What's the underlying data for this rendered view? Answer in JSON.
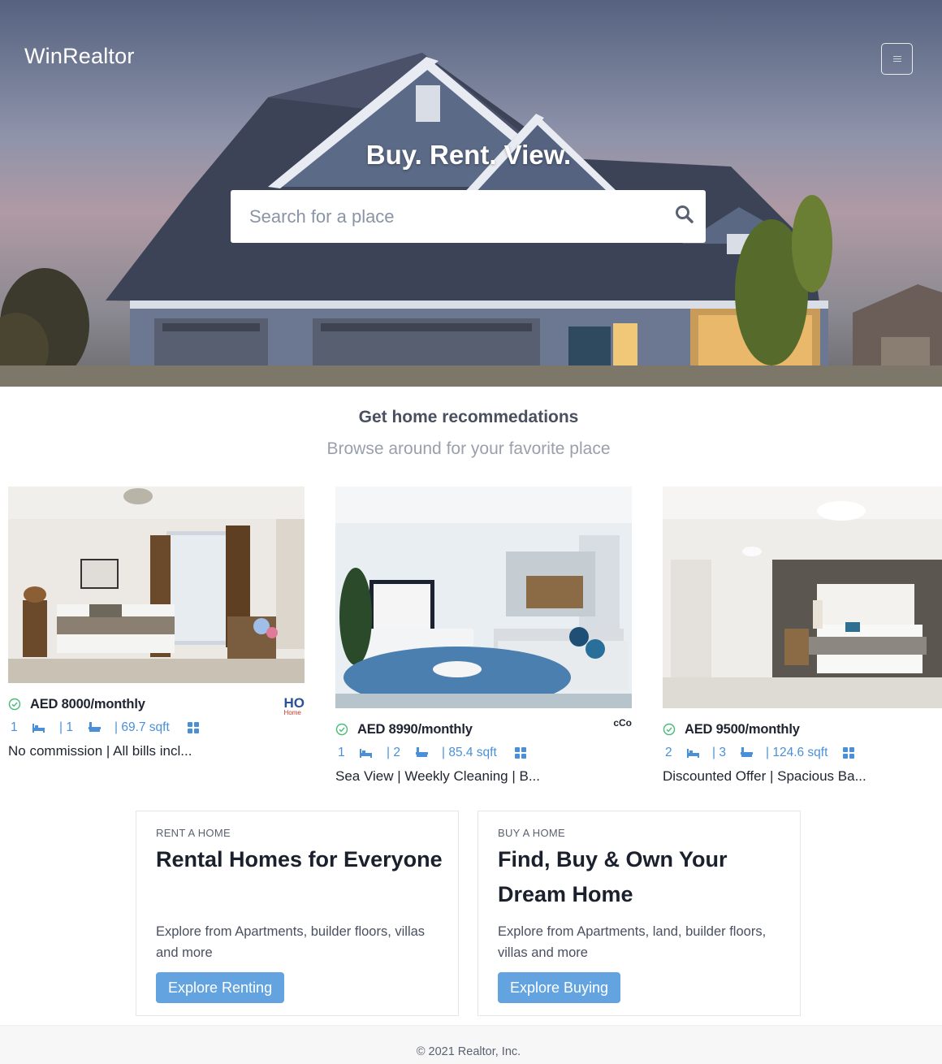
{
  "header": {
    "brand": "WinRealtor",
    "menu_icon": "hamburger-menu-icon"
  },
  "hero": {
    "tagline": "Buy. Rent. View.",
    "search": {
      "placeholder": "Search for a place",
      "icon": "search-icon"
    }
  },
  "recommendations": {
    "title": "Get home recommedations",
    "subtitle": "Browse around for your favorite place",
    "listings": [
      {
        "price": "AED 8000/monthly",
        "beds": "1",
        "baths": "| 1",
        "area": "| 69.7 sqft",
        "description": "No commission | All bills incl...",
        "agency_logo_text": "HO",
        "agency_logo_sub": "Home"
      },
      {
        "price": "AED 8990/monthly",
        "beds": "1",
        "baths": "| 2",
        "area": "| 85.4 sqft",
        "description": "Sea View | Weekly Cleaning | B...",
        "agency_logo_text": "cCo",
        "agency_logo_sub": ""
      },
      {
        "price": "AED 9500/monthly",
        "beds": "2",
        "baths": "| 3",
        "area": "| 124.6 sqft",
        "description": "Discounted Offer | Spacious Ba...",
        "agency_logo_text": "",
        "agency_logo_sub": ""
      }
    ]
  },
  "cta": {
    "rent": {
      "eyebrow": "RENT A HOME",
      "headline": "Rental Homes for Everyone",
      "body": "Explore from Apartments, builder floors, villas and more",
      "button": "Explore Renting"
    },
    "buy": {
      "eyebrow": "BUY A HOME",
      "headline": "Find, Buy & Own Your Dream Home",
      "body": "Explore from Apartments, land, builder floors, villas and more",
      "button": "Explore Buying"
    }
  },
  "footer": {
    "copyright": "© 2021 Realtor, Inc."
  },
  "colors": {
    "accent": "#63a4e0",
    "spec_blue": "#4a90d9",
    "check_green": "#48bb78",
    "heading": "#1a202c"
  }
}
